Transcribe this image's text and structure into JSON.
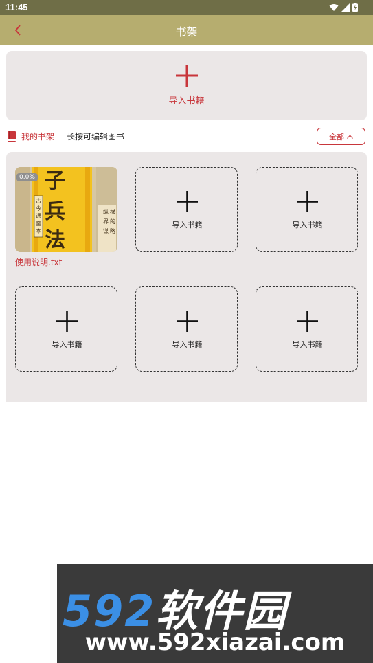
{
  "status_bar": {
    "time": "11:45"
  },
  "app_bar": {
    "title": "书架"
  },
  "import_card": {
    "label": "导入书籍"
  },
  "shelf_header": {
    "my_shelf_label": "我的书架",
    "hint": "长按可编辑图书",
    "filter_label": "全部"
  },
  "books": [
    {
      "name": "使用说明.txt",
      "progress": "0.0%",
      "cover_text": [
        "子",
        "兵",
        "法"
      ],
      "cover_subtitle": "古今通鉴本"
    }
  ],
  "empty_slot_label": "导入书籍",
  "watermark": {
    "brand_num": "592",
    "brand_text": "软件园",
    "url": "www.592xiazai.com"
  },
  "colors": {
    "accent": "#c8363b",
    "app_bar": "#b6ad6f",
    "status_bar": "#6f6e47",
    "panel": "#ebe7e7"
  },
  "icons": {
    "back": "chevron-left-icon",
    "add": "plus-icon",
    "book": "book-icon",
    "filter": "chevron-up-icon"
  }
}
